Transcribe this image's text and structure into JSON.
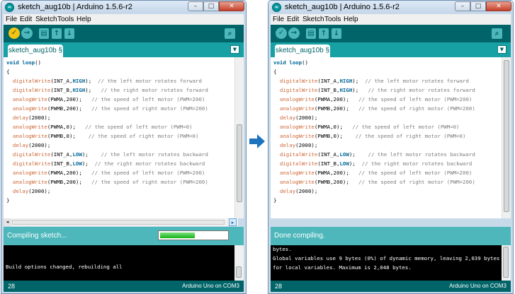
{
  "app_title": "sketch_aug10b | Arduino 1.5.6-r2",
  "window_controls": {
    "minimize": "–",
    "maximize": "□",
    "close": "✕"
  },
  "menu": [
    "File",
    "Edit",
    "Sketch",
    "Tools",
    "Help"
  ],
  "toolbar": {
    "verify": "✓",
    "upload": "→",
    "new": "▤",
    "open": "↑",
    "save": "↓",
    "serial": "⌕"
  },
  "tab_label": "sketch_aug10b §",
  "tab_menu_icon": "▼",
  "code": [
    [
      {
        "t": "void",
        "c": "kw2"
      },
      {
        "t": " "
      },
      {
        "t": "loop",
        "c": "kw2"
      },
      {
        "t": "()"
      }
    ],
    [
      {
        "t": "{"
      }
    ],
    [
      {
        "t": "  "
      },
      {
        "t": "digitalWrite",
        "c": "fn"
      },
      {
        "t": "(INT_A,"
      },
      {
        "t": "HIGH",
        "c": "kw2"
      },
      {
        "t": ");  "
      },
      {
        "t": "// the left motor rotates forward",
        "c": "cm"
      }
    ],
    [
      {
        "t": "  "
      },
      {
        "t": "digitalWrite",
        "c": "fn"
      },
      {
        "t": "(INT_B,"
      },
      {
        "t": "HIGH",
        "c": "kw2"
      },
      {
        "t": ");   "
      },
      {
        "t": "// the right motor rotates forward",
        "c": "cm"
      }
    ],
    [
      {
        "t": "  "
      },
      {
        "t": "analogWrite",
        "c": "fn"
      },
      {
        "t": "(PWMA,200);   "
      },
      {
        "t": "// the speed of left motor (PWM=200)",
        "c": "cm"
      }
    ],
    [
      {
        "t": "  "
      },
      {
        "t": "analogWrite",
        "c": "fn"
      },
      {
        "t": "(PWMB,200);   "
      },
      {
        "t": "// the speed of right motor (PWM=200)",
        "c": "cm"
      }
    ],
    [
      {
        "t": "  "
      },
      {
        "t": "delay",
        "c": "fn"
      },
      {
        "t": "(2000);"
      }
    ],
    [
      {
        "t": "  "
      },
      {
        "t": "analogWrite",
        "c": "fn"
      },
      {
        "t": "(PWMA,0);   "
      },
      {
        "t": "// the speed of left motor (PWM=0)",
        "c": "cm"
      }
    ],
    [
      {
        "t": "  "
      },
      {
        "t": "analogWrite",
        "c": "fn"
      },
      {
        "t": "(PWMB,0);    "
      },
      {
        "t": "// the speed of right motor (PWM=0)",
        "c": "cm"
      }
    ],
    [
      {
        "t": "  "
      },
      {
        "t": "delay",
        "c": "fn"
      },
      {
        "t": "(2000);"
      }
    ],
    [
      {
        "t": "  "
      },
      {
        "t": "digitalWrite",
        "c": "fn"
      },
      {
        "t": "(INT_A,"
      },
      {
        "t": "LOW",
        "c": "kw2"
      },
      {
        "t": ");    "
      },
      {
        "t": "// the left motor rotates backward",
        "c": "cm"
      }
    ],
    [
      {
        "t": "  "
      },
      {
        "t": "digitalWrite",
        "c": "fn"
      },
      {
        "t": "(INT_B,"
      },
      {
        "t": "LOW",
        "c": "kw2"
      },
      {
        "t": ");  "
      },
      {
        "t": "// the right motor rotates backward",
        "c": "cm"
      }
    ],
    [
      {
        "t": "  "
      },
      {
        "t": "analogWrite",
        "c": "fn"
      },
      {
        "t": "(PWMA,200);   "
      },
      {
        "t": "// the speed of left motor (PWM=200)",
        "c": "cm"
      }
    ],
    [
      {
        "t": "  "
      },
      {
        "t": "analogWrite",
        "c": "fn"
      },
      {
        "t": "(PWMB,200);   "
      },
      {
        "t": "// the speed of right motor (PWM=200)",
        "c": "cm"
      }
    ],
    [
      {
        "t": "  "
      },
      {
        "t": "delay",
        "c": "fn"
      },
      {
        "t": "(2000);"
      }
    ],
    [
      {
        "t": "}"
      }
    ]
  ],
  "left": {
    "status": "Compiling sketch...",
    "progress_fraction": 0.52,
    "console": [
      "",
      "",
      "Build options changed, rebuilding all"
    ]
  },
  "right": {
    "status": "Done compiling.",
    "console": [
      "bytes.",
      "Global variables use 9 bytes (0%) of dynamic memory, leaving 2,039 bytes",
      "for local variables. Maximum is 2,048 bytes."
    ]
  },
  "footer": {
    "line": "28",
    "board": "Arduino Uno on COM3"
  },
  "colors": {
    "toolbar": "#006468",
    "tabbar": "#17a1a5",
    "status": "#4db7bb",
    "arrow": "#1e73be",
    "verify": "#f2c418"
  },
  "icons": {
    "left_scroll": "◂",
    "right_scroll": "▸",
    "transition_arrow": "arrow-right-icon"
  }
}
